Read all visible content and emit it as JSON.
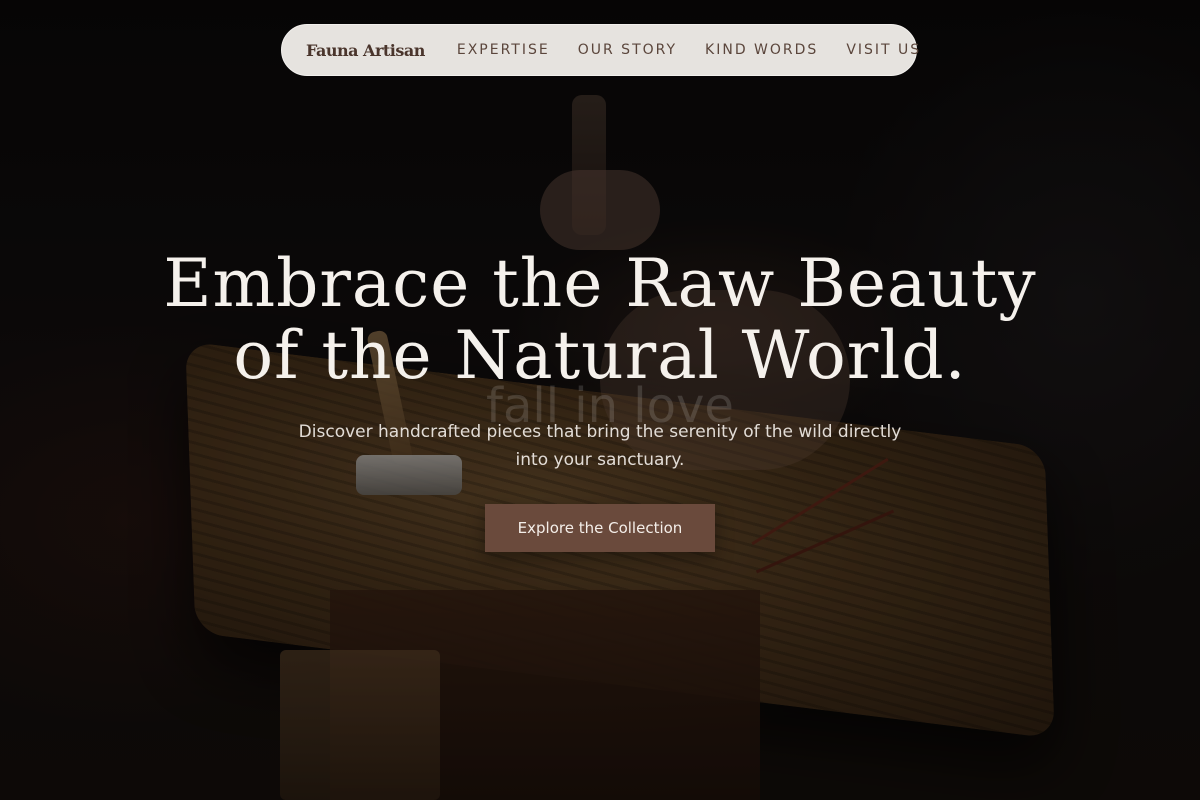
{
  "nav": {
    "brand": "Fauna Artisan",
    "links": [
      "EXPERTISE",
      "OUR STORY",
      "KIND WORDS",
      "VISIT US"
    ]
  },
  "hero": {
    "headline_line1": "Embrace the Raw Beauty",
    "headline_line2": "of the Natural World.",
    "subheading_line1": "Discover handcrafted pieces that bring the serenity of the wild directly",
    "subheading_line2": "into your sanctuary.",
    "cta_label": "Explore the Collection",
    "watermark": "fall in love"
  },
  "colors": {
    "nav_background": "#e6e3df",
    "brand_text": "#4a352c",
    "cta_background": "#6a4a3c",
    "headline_text": "#f5f1ec"
  }
}
